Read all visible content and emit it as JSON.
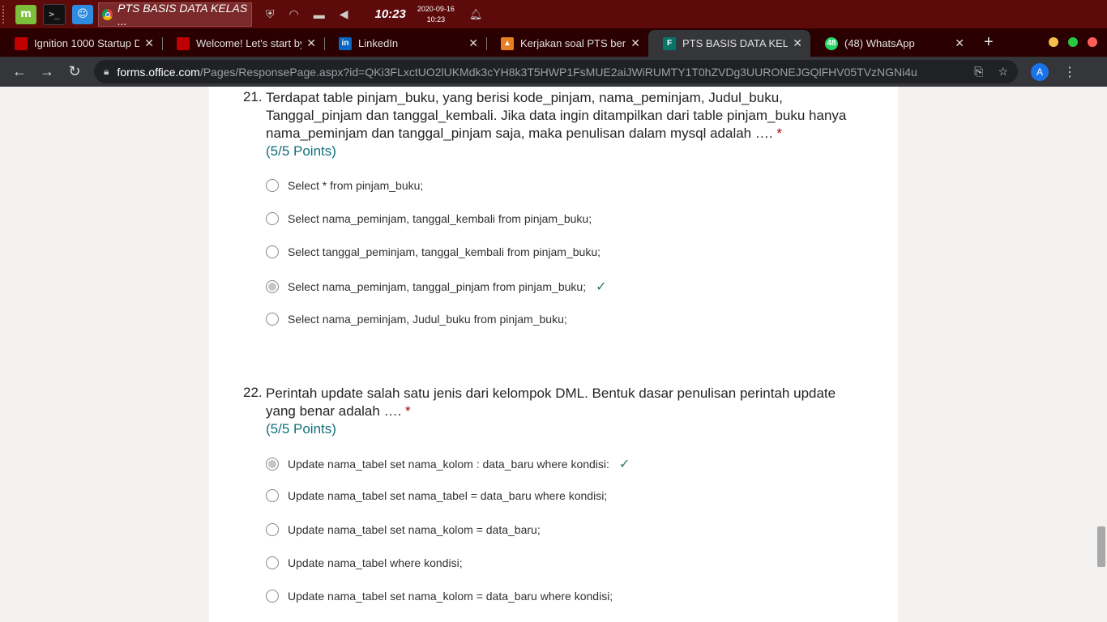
{
  "taskbar": {
    "active_task": "PTS BASIS DATA KELAS ...",
    "clock": "10:23",
    "date": "2020-09-16",
    "date_time": "10:23"
  },
  "tabs": [
    {
      "title": "Ignition 1000 Startup D",
      "fav_color": "#c00000"
    },
    {
      "title": "Welcome! Let's start by",
      "fav_color": "#c00000"
    },
    {
      "title": "LinkedIn",
      "fav_color": "#0a66c2"
    },
    {
      "title": "Kerjakan soal PTS beril",
      "fav_color": "#e67e22"
    },
    {
      "title": "PTS BASIS DATA KELAS",
      "fav_color": "#077568"
    },
    {
      "title": "(48) WhatsApp",
      "fav_color": "#25d366",
      "badge": "48"
    }
  ],
  "address": {
    "host": "forms.office.com",
    "path": "/Pages/ResponsePage.aspx?id=QKi3FLxctUO2lUKMdk3cYH8k3T5HWP1FsMUE2aiJWiRUMTY1T0hZVDg3UURONEJGQlFHV05TVzNGNi4u",
    "avatar": "A"
  },
  "questions": [
    {
      "number": "21.",
      "text": "Terdapat table pinjam_buku, yang berisi kode_pinjam, nama_peminjam, Judul_buku, Tanggal_pinjam dan tanggal_kembali. Jika data ingin ditampilkan dari table pinjam_buku hanya nama_peminjam dan tanggal_pinjam saja, maka penulisan dalam mysql adalah ….",
      "required": "*",
      "points": "(5/5 Points)",
      "options": [
        {
          "label": "Select * from pinjam_buku;"
        },
        {
          "label": "Select nama_peminjam, tanggal_kembali from pinjam_buku;"
        },
        {
          "label": "Select tanggal_peminjam, tanggal_kembali from pinjam_buku;"
        },
        {
          "label": "Select nama_peminjam, tanggal_pinjam from pinjam_buku;"
        },
        {
          "label": "Select nama_peminjam, Judul_buku from pinjam_buku;"
        }
      ]
    },
    {
      "number": "22.",
      "text": "Perintah update salah satu jenis dari kelompok DML. Bentuk dasar penulisan perintah update yang benar adalah ….",
      "required": "*",
      "points": "(5/5 Points)",
      "options": [
        {
          "label": "Update nama_tabel set nama_kolom : data_baru where kondisi:"
        },
        {
          "label": "Update nama_tabel set nama_tabel = data_baru where kondisi;"
        },
        {
          "label": "Update nama_tabel set nama_kolom = data_baru;"
        },
        {
          "label": "Update nama_tabel where kondisi;"
        },
        {
          "label": "Update nama_tabel set nama_kolom = data_baru where kondisi;"
        }
      ]
    }
  ]
}
